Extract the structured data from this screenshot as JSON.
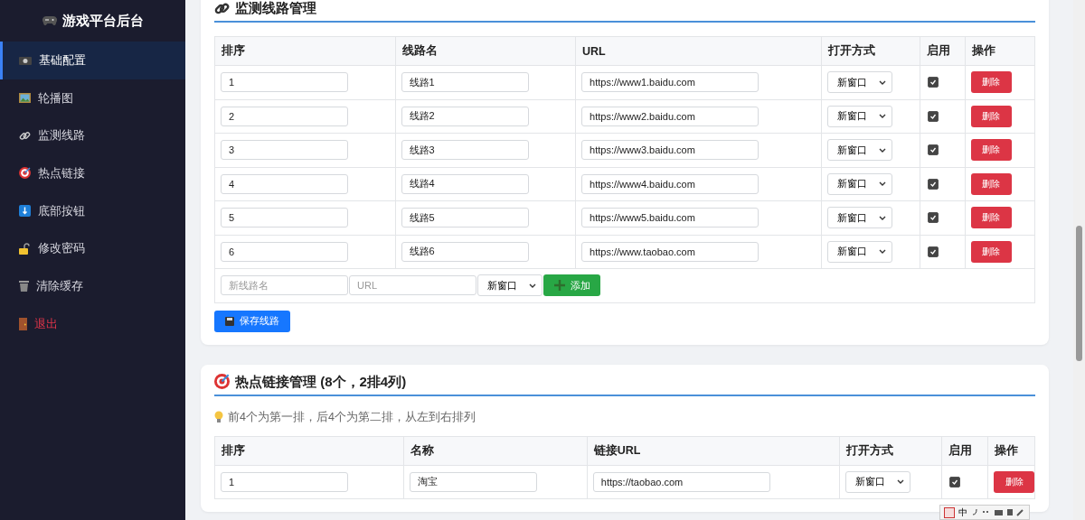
{
  "sidebar": {
    "title": "游戏平台后台",
    "items": [
      {
        "label": "基础配置",
        "selected": true,
        "kind": "normal"
      },
      {
        "label": "轮播图",
        "selected": false,
        "kind": "normal"
      },
      {
        "label": "监测线路",
        "selected": false,
        "kind": "normal"
      },
      {
        "label": "热点链接",
        "selected": false,
        "kind": "normal"
      },
      {
        "label": "底部按钮",
        "selected": false,
        "kind": "normal"
      },
      {
        "label": "修改密码",
        "selected": false,
        "kind": "normal"
      },
      {
        "label": "清除缓存",
        "selected": false,
        "kind": "normal"
      },
      {
        "label": "退出",
        "selected": false,
        "kind": "danger"
      }
    ]
  },
  "lines_section": {
    "title": "监测线路管理",
    "columns": [
      "排序",
      "线路名",
      "URL",
      "打开方式",
      "启用",
      "操作"
    ],
    "rows": [
      {
        "order": "1",
        "name": "线路1",
        "url": "https://www1.baidu.com",
        "open_mode": "新窗口",
        "enabled": true,
        "action": "删除"
      },
      {
        "order": "2",
        "name": "线路2",
        "url": "https://www2.baidu.com",
        "open_mode": "新窗口",
        "enabled": true,
        "action": "删除"
      },
      {
        "order": "3",
        "name": "线路3",
        "url": "https://www3.baidu.com",
        "open_mode": "新窗口",
        "enabled": true,
        "action": "删除"
      },
      {
        "order": "4",
        "name": "线路4",
        "url": "https://www4.baidu.com",
        "open_mode": "新窗口",
        "enabled": true,
        "action": "删除"
      },
      {
        "order": "5",
        "name": "线路5",
        "url": "https://www5.baidu.com",
        "open_mode": "新窗口",
        "enabled": true,
        "action": "删除"
      },
      {
        "order": "6",
        "name": "线路6",
        "url": "https://www.taobao.com",
        "open_mode": "新窗口",
        "enabled": true,
        "action": "删除"
      }
    ],
    "new_row": {
      "name_placeholder": "新线路名",
      "url_placeholder": "URL",
      "open_mode": "新窗口",
      "add_button": "添加"
    },
    "save_button": "保存线路"
  },
  "hot_section": {
    "title": "热点链接管理 (8个，2排4列)",
    "tip": "前4个为第一排，后4个为第二排，从左到右排列",
    "columns": [
      "排序",
      "名称",
      "链接URL",
      "打开方式",
      "启用",
      "操作"
    ],
    "rows": [
      {
        "order": "1",
        "name": "淘宝",
        "url": "https://taobao.com",
        "open_mode": "新窗口",
        "enabled": true,
        "action": "删除"
      }
    ]
  },
  "ime_bar": {
    "label": "中"
  }
}
